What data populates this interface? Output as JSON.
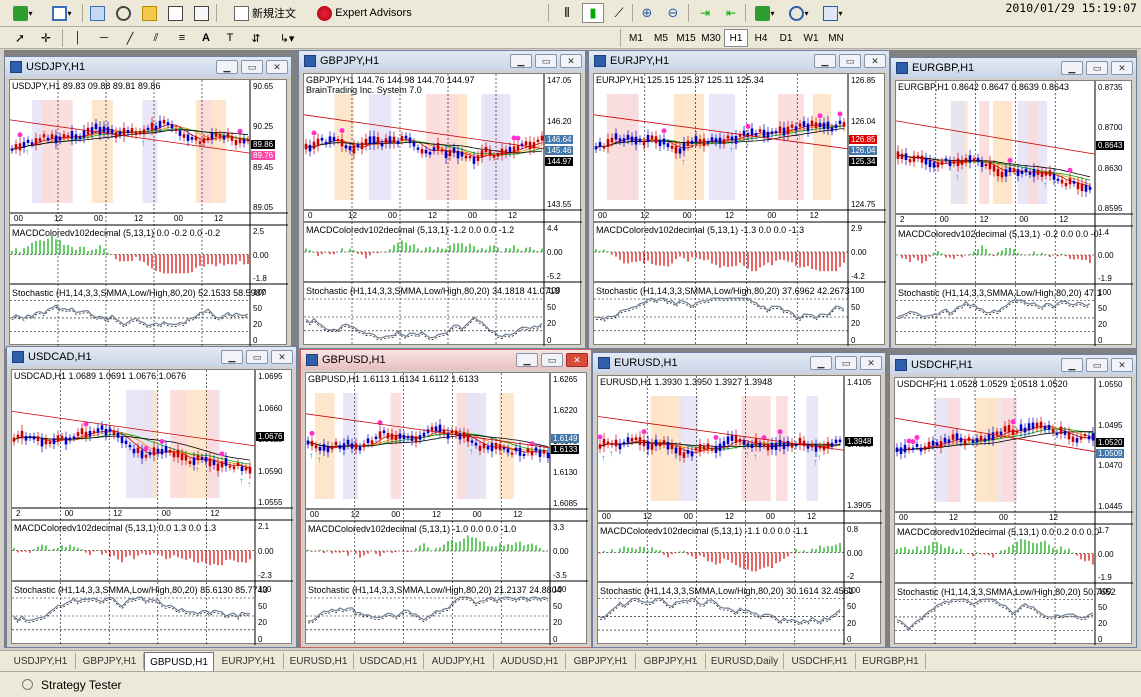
{
  "clock": "2010/01/29 15:19:07",
  "toolbar": {
    "new_order": "新規注文",
    "expert_advisors": "Expert Advisors",
    "timeframes": [
      "M1",
      "M5",
      "M15",
      "M30",
      "H1",
      "H4",
      "D1",
      "W1",
      "MN"
    ],
    "active_timeframe": "H1"
  },
  "windows": [
    {
      "title": "USDJPY,H1",
      "info": "USDJPY,H1  89.83 09.88 89.81 89.86",
      "extra": "",
      "prices": [
        "90.65",
        "90.25",
        "89.45",
        "89.05"
      ],
      "badges": [
        {
          "text": "89.86",
          "color": "#000000"
        },
        {
          "text": "89.76",
          "color": "#ff44aa"
        }
      ],
      "times": [
        "00",
        "12",
        "00",
        "12",
        "00",
        "12"
      ],
      "macd": "MACDColoredv102decimal (5,13,1) 0.0 -0.2 0.0 -0.2",
      "macd_scale": [
        "2.5",
        "0.00",
        "-1.8"
      ],
      "stoch": "Stochastic (H1,14,3,3,SMMA,Low/High,80,20) 52.1533 58.5987",
      "stoch_scale": [
        "100",
        "50",
        "20",
        "0"
      ]
    },
    {
      "title": "GBPJPY,H1",
      "info": "GBPJPY,H1  144.76 144.98 144.70 144.97",
      "extra": "BrainTrading Inc. System 7.0",
      "prices": [
        "147.05",
        "146.20",
        "144.40",
        "143.55"
      ],
      "badges": [
        {
          "text": "146.64",
          "color": "#4477aa"
        },
        {
          "text": "145.46",
          "color": "#4477aa"
        },
        {
          "text": "144.97",
          "color": "#000000"
        }
      ],
      "times": [
        "0",
        "12",
        "00",
        "12",
        "00",
        "12"
      ],
      "macd": "MACDColoredv102decimal (5,13,1) -1.2 0.0 0.0 -1.2",
      "macd_scale": [
        "4.4",
        "0.00",
        "-5.2"
      ],
      "stoch": "Stochastic (H1,14,3,3,SMMA,Low/High,80,20) 34.1818 41.0713",
      "stoch_scale": [
        "100",
        "50",
        "20",
        "0"
      ]
    },
    {
      "title": "EURJPY,H1",
      "info": "EURJPY,H1  125.15 125.37 125.11 125.34",
      "extra": "",
      "prices": [
        "126.85",
        "126.04",
        "125.34",
        "124.75"
      ],
      "badges": [
        {
          "text": "126.85",
          "color": "#dd0000"
        },
        {
          "text": "126.04",
          "color": "#4477aa"
        },
        {
          "text": "125.34",
          "color": "#000000"
        }
      ],
      "times": [
        "00",
        "12",
        "00",
        "12",
        "00",
        "12"
      ],
      "macd": "MACDColoredv102decimal (5,13,1) -1.3 0.0 0.0 -1.3",
      "macd_scale": [
        "2.9",
        "0.00",
        "-4.2"
      ],
      "stoch": "Stochastic (H1,14,3,3,SMMA,Low/High,80,20) 37.6962 42.2673",
      "stoch_scale": [
        "100",
        "50",
        "20",
        "0"
      ]
    },
    {
      "title": "EURGBP,H1",
      "info": "EURGBP,H1  0.8642 0.8647 0.8639 0.8643",
      "extra": "",
      "prices": [
        "0.8735",
        "0.8700",
        "0.8630",
        "0.8595"
      ],
      "badges": [
        {
          "text": "0.8643",
          "color": "#000000"
        }
      ],
      "times": [
        "2",
        "00",
        "12",
        "00",
        "12"
      ],
      "macd": "MACDColoredv102decimal (5,13,1) -0.2 0.0 0.0 -0.",
      "macd_scale": [
        "1.4",
        "0.00",
        "-1.9"
      ],
      "stoch": "Stochastic (H1,14,3,3,SMMA,Low/High,80,20) 47.1",
      "stoch_scale": [
        "100",
        "50",
        "20",
        "0"
      ]
    },
    {
      "title": "USDCAD,H1",
      "info": "USDCAD,H1  1.0689 1.0691 1.0676 1.0676",
      "extra": "",
      "prices": [
        "1.0695",
        "1.0660",
        "1.0625",
        "1.0590",
        "1.0555"
      ],
      "badges": [
        {
          "text": "1.0676",
          "color": "#000000"
        }
      ],
      "times": [
        "2",
        "00",
        "12",
        "00",
        "12"
      ],
      "macd": "MACDColoredv102decimal (5,13,1) 0.0 1.3 0.0 1.3",
      "macd_scale": [
        "2.1",
        "0.00",
        "-2.3"
      ],
      "stoch": "Stochastic (H1,14,3,3,SMMA,Low/High,80,20) 85.6130 85.7743",
      "stoch_scale": [
        "100",
        "50",
        "20",
        "0"
      ]
    },
    {
      "title": "GBPUSD,H1",
      "info": "GBPUSD,H1  1.6113 1.6134 1.6112 1.6133",
      "extra": "",
      "prices": [
        "1.6265",
        "1.6220",
        "1.6175",
        "1.6130",
        "1.6085"
      ],
      "badges": [
        {
          "text": "1.6149",
          "color": "#4477aa"
        },
        {
          "text": "1.6133",
          "color": "#000000"
        }
      ],
      "times": [
        "00",
        "12",
        "00",
        "12",
        "00",
        "12"
      ],
      "macd": "MACDColoredv102decimal (5,13,1) -1.0 0.0 0.0 -1.0",
      "macd_scale": [
        "3.3",
        "0.00",
        "-3.5"
      ],
      "stoch": "Stochastic (H1,14,3,3,SMMA,Low/High,80,20) 21.2137 24.8804",
      "stoch_scale": [
        "100",
        "50",
        "20",
        "0"
      ]
    },
    {
      "title": "EURUSD,H1",
      "info": "EURUSD,H1  1.3930 1.3950 1.3927 1.3948",
      "extra": "",
      "prices": [
        "1.4105",
        "1.4005",
        "1.3905"
      ],
      "badges": [
        {
          "text": "1.3948",
          "color": "#000000"
        }
      ],
      "times": [
        "00",
        "12",
        "00",
        "12",
        "00",
        "12"
      ],
      "macd": "MACDColoredv102decimal (5,13,1) -1.1 0.0 0.0 -1.1",
      "macd_scale": [
        "0.8",
        "0.00",
        "-2"
      ],
      "stoch": "Stochastic (H1,14,3,3,SMMA,Low/High,80,20) 30.1614 32.4561",
      "stoch_scale": [
        "100",
        "50",
        "20",
        "0"
      ]
    },
    {
      "title": "USDCHF,H1",
      "info": "USDCHF,H1  1.0528 1.0529 1.0518 1.0520",
      "extra": "",
      "prices": [
        "1.0550",
        "1.0495",
        "1.0470",
        "1.0445"
      ],
      "badges": [
        {
          "text": "1.0520",
          "color": "#000000"
        },
        {
          "text": "1.0509",
          "color": "#4477aa"
        }
      ],
      "times": [
        "00",
        "12",
        "00",
        "12"
      ],
      "macd": "MACDColoredv102decimal (5,13,1) 0.0 0.2 0.0 0.0",
      "macd_scale": [
        "1.7",
        "0.00",
        "-1.9"
      ],
      "stoch": "Stochastic (H1,14,3,3,SMMA,Low/High,80,20) 50.7652",
      "stoch_scale": [
        "100",
        "50",
        "20",
        "0"
      ]
    }
  ],
  "tabs": [
    "USDJPY,H1",
    "GBPJPY,H1",
    "GBPUSD,H1",
    "EURJPY,H1",
    "EURUSD,H1",
    "USDCAD,H1",
    "AUDJPY,H1",
    "AUDUSD,H1",
    "GBPJPY,H1",
    "GBPJPY,H1",
    "EURUSD,Daily",
    "USDCHF,H1",
    "EURGBP,H1"
  ],
  "active_tab": 2,
  "status": {
    "label": "Strategy Tester"
  }
}
